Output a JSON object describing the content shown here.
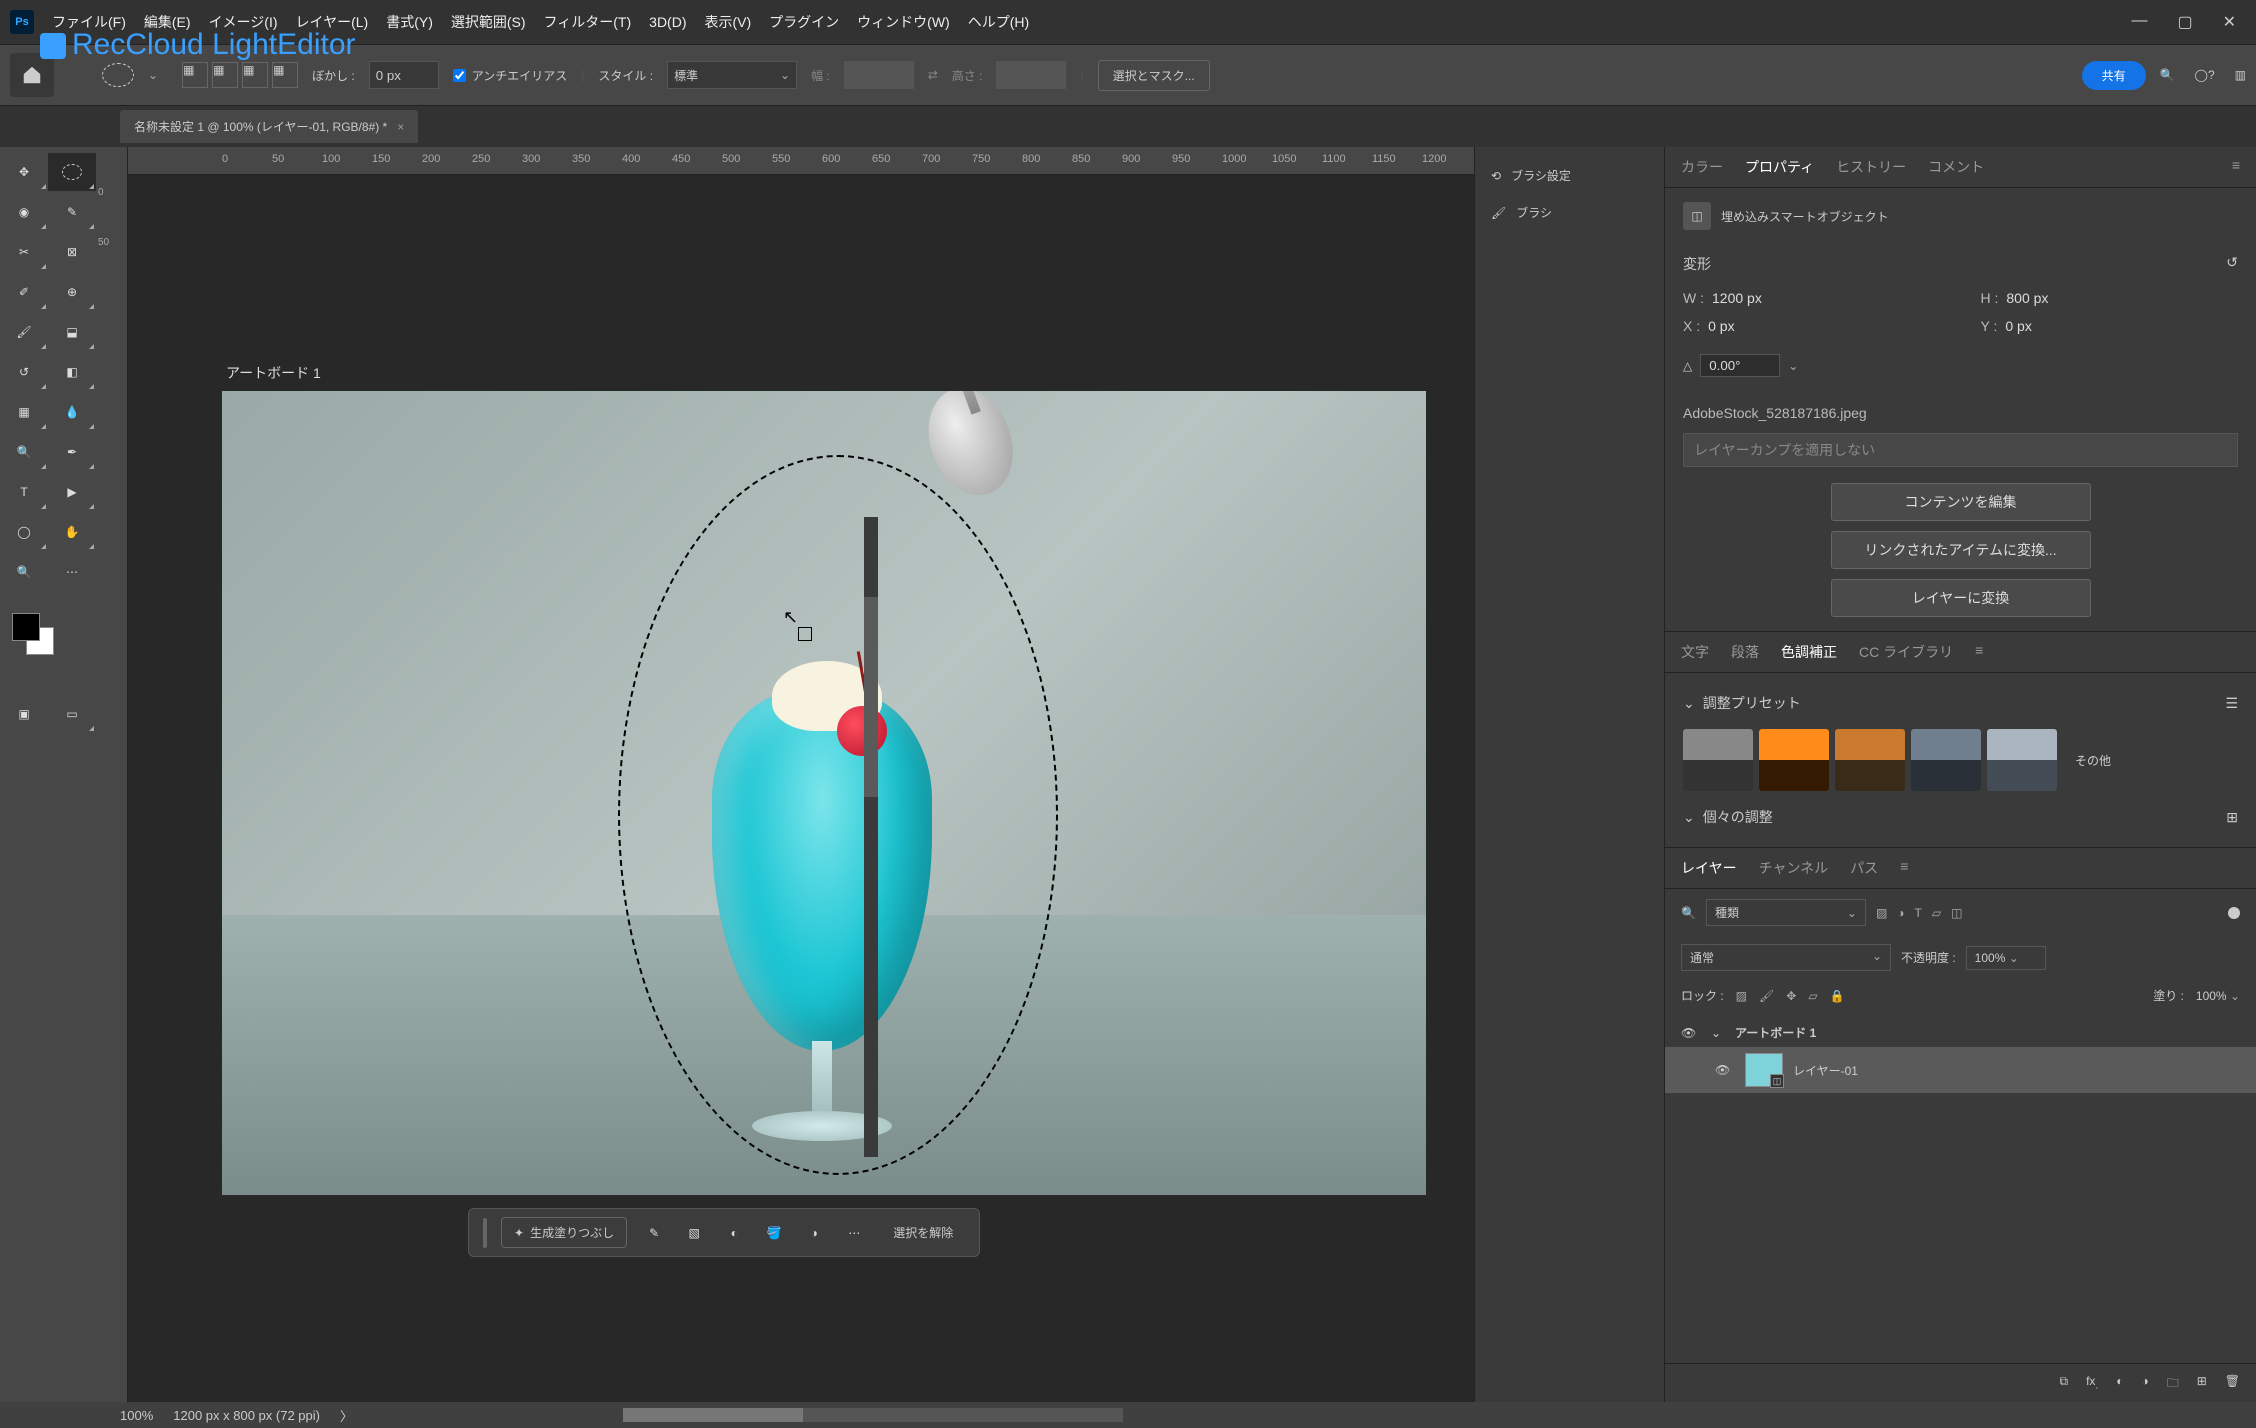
{
  "menu": {
    "items": [
      "ファイル(F)",
      "編集(E)",
      "イメージ(I)",
      "レイヤー(L)",
      "書式(Y)",
      "選択範囲(S)",
      "フィルター(T)",
      "3D(D)",
      "表示(V)",
      "プラグイン",
      "ウィンドウ(W)",
      "ヘルプ(H)"
    ]
  },
  "watermark": "RecCloud LightEditor",
  "options": {
    "feather_label": "ぼかし :",
    "feather_value": "0 px",
    "antialias": "アンチエイリアス",
    "style_label": "スタイル :",
    "style_value": "標準",
    "width_label": "幅 :",
    "height_label": "高さ :",
    "select_mask": "選択とマスク...",
    "share": "共有"
  },
  "tab": {
    "title": "名称未設定 1 @ 100% (レイヤー-01, RGB/8#) *"
  },
  "ruler_h": [
    "0",
    "50",
    "100",
    "150",
    "200",
    "250",
    "300",
    "350",
    "400",
    "450",
    "500",
    "550",
    "600",
    "650",
    "700",
    "750",
    "800",
    "850",
    "900",
    "950",
    "1000",
    "1050",
    "1100",
    "1150",
    "1200"
  ],
  "artboard_label": "アートボード 1",
  "context_bar": {
    "generate": "生成塗りつぶし",
    "deselect": "選択を解除"
  },
  "mid_panels": {
    "brush_settings": "ブラシ設定",
    "brush": "ブラシ"
  },
  "panel_tabs": {
    "color": "カラー",
    "properties": "プロパティ",
    "history": "ヒストリー",
    "comments": "コメント"
  },
  "properties": {
    "header": "埋め込みスマートオブジェクト",
    "transform": "変形",
    "w_label": "W :",
    "w_val": "1200 px",
    "h_label": "H :",
    "h_val": "800 px",
    "x_label": "X :",
    "x_val": "0 px",
    "y_label": "Y :",
    "y_val": "0 px",
    "angle": "0.00°",
    "filename": "AdobeStock_528187186.jpeg",
    "layer_comp": "レイヤーカンプを適用しない",
    "btn_edit": "コンテンツを編集",
    "btn_linked": "リンクされたアイテムに変換...",
    "btn_raster": "レイヤーに変換"
  },
  "secondary_tabs": {
    "char": "文字",
    "para": "段落",
    "adjust": "色調補正",
    "cclib": "CC ライブラリ"
  },
  "adjust": {
    "presets": "調整プリセット",
    "more": "その他",
    "individual": "個々の調整"
  },
  "layers_tabs": {
    "layers": "レイヤー",
    "channels": "チャンネル",
    "paths": "パス"
  },
  "layers": {
    "kind_filter": "種類",
    "blend": "通常",
    "opacity_label": "不透明度 :",
    "opacity": "100%",
    "lock_label": "ロック :",
    "fill_label": "塗り :",
    "fill": "100%",
    "artboard_name": "アートボード 1",
    "layer_name": "レイヤー-01"
  },
  "status": {
    "zoom": "100%",
    "dims": "1200 px x 800 px (72 ppi)"
  }
}
